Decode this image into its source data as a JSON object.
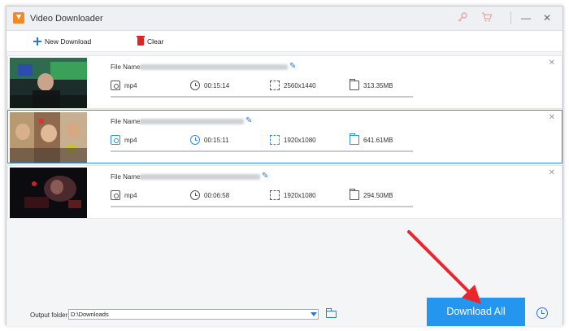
{
  "window": {
    "title": "Video Downloader",
    "icons": [
      "download-app-icon",
      "key-icon",
      "cart-icon",
      "minimize-icon",
      "close-icon"
    ],
    "minimize_glyph": "—",
    "close_glyph": "✕"
  },
  "toolbar": {
    "new_download_label": "New Download",
    "clear_label": "Clear"
  },
  "downloads": [
    {
      "file_label": "File Name:",
      "format": "mp4",
      "duration": "00:15:14",
      "resolution": "2560x1440",
      "size": "313.35MB",
      "selected": false
    },
    {
      "file_label": "File Name:",
      "format": "mp4",
      "duration": "00:15:11",
      "resolution": "1920x1080",
      "size": "641.61MB",
      "selected": true
    },
    {
      "file_label": "File Name:",
      "format": "mp4",
      "duration": "00:06:58",
      "resolution": "1920x1080",
      "size": "294.50MB",
      "selected": false
    }
  ],
  "footer": {
    "output_folder_label": "Output folder:",
    "output_folder_value": "D:\\Downloads",
    "download_all_label": "Download All"
  },
  "colors": {
    "accent": "#2596ef",
    "annotation_arrow": "#e8262b",
    "selected_border": "#2f8ee6"
  }
}
